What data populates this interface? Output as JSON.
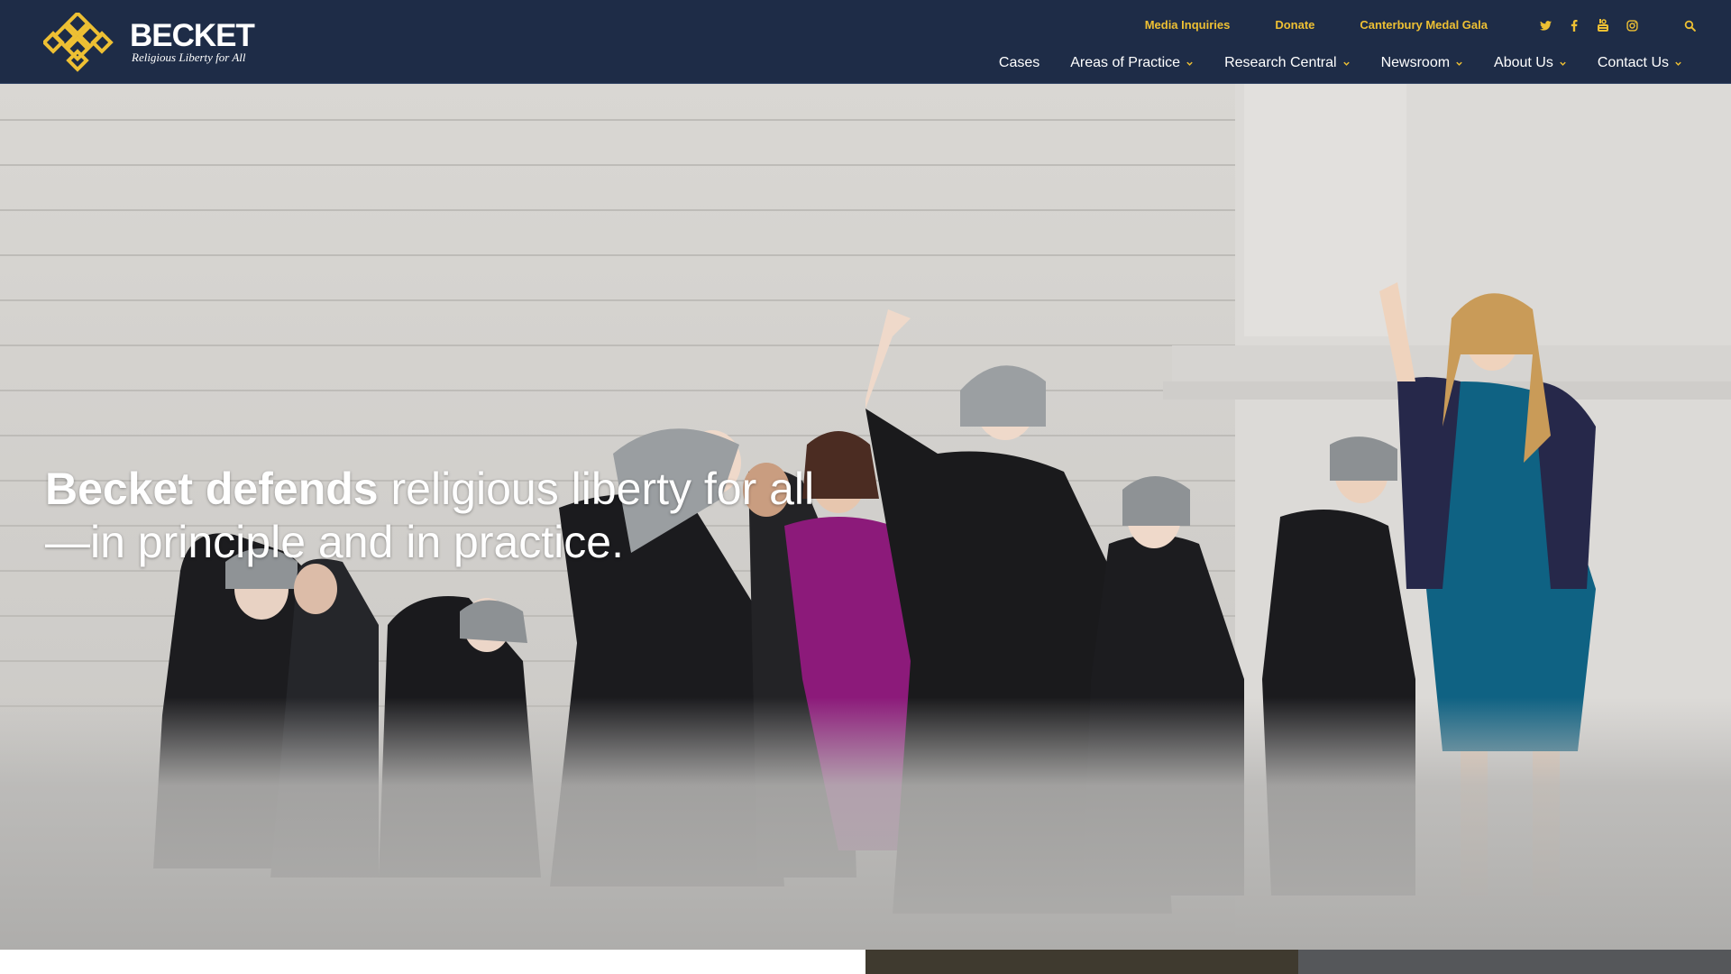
{
  "brand": {
    "name": "BECKET",
    "tagline": "Religious Liberty for All",
    "logo_icon": "interlaced-knot-logo-icon",
    "colors": {
      "navy": "#1e2c47",
      "gold": "#eec033",
      "white": "#ffffff"
    }
  },
  "utility_nav": {
    "media": "Media Inquiries",
    "donate": "Donate",
    "gala": "Canterbury Medal Gala"
  },
  "social_icons": [
    "twitter-icon",
    "facebook-icon",
    "youtube-icon",
    "instagram-icon"
  ],
  "main_nav": {
    "cases": "Cases",
    "practice": "Areas of Practice",
    "research": "Research Central",
    "newsroom": "Newsroom",
    "about": "About Us",
    "contact": "Contact Us"
  },
  "hero": {
    "headline_bold": "Becket defends",
    "headline_rest": "religious liberty for all—in principle and in practice."
  }
}
